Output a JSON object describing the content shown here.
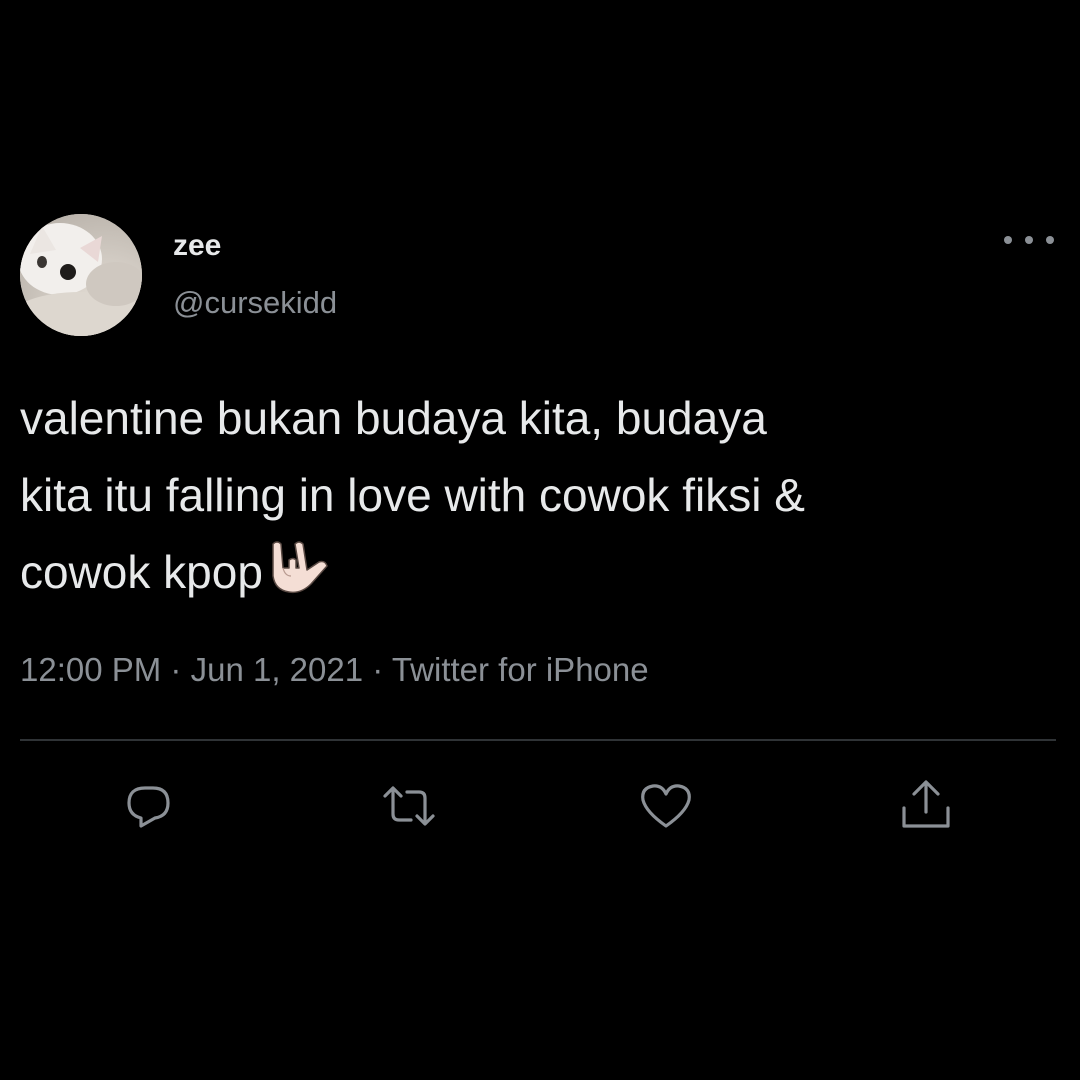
{
  "author": {
    "display_name": "zee",
    "handle": "@cursekidd",
    "avatar_icon": "avatar-image"
  },
  "tweet": {
    "text": "valentine bukan budaya kita, budaya\nkita itu falling in love with cowok fiksi &\ncowok kpop",
    "emoji": "love-you-gesture-hand"
  },
  "meta": {
    "time": "12:00 PM",
    "date": "Jun 1, 2021",
    "source": "Twitter for iPhone",
    "separator": "·"
  },
  "actions": [
    {
      "name": "reply",
      "icon": "reply-icon"
    },
    {
      "name": "retweet",
      "icon": "retweet-icon"
    },
    {
      "name": "like",
      "icon": "heart-icon"
    },
    {
      "name": "share",
      "icon": "share-icon"
    }
  ],
  "colors": {
    "background": "#000000",
    "primary_text": "#e7e9ea",
    "secondary_text": "#8b9096",
    "divider": "#2f3336"
  }
}
